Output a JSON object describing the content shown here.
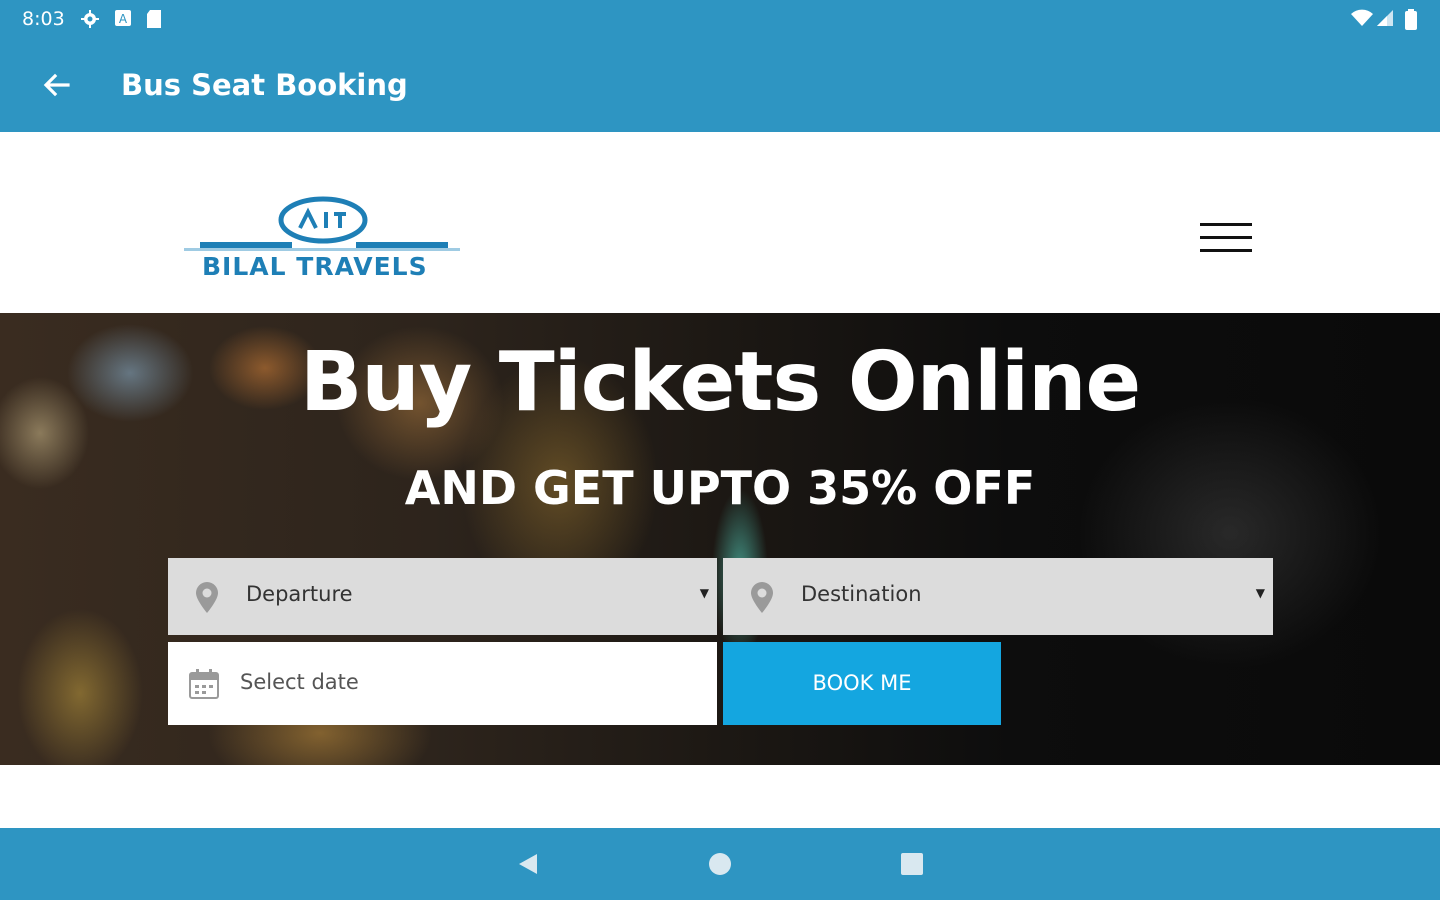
{
  "status_bar": {
    "time": "8:03",
    "left_icons": [
      "gear-icon",
      "a-icon",
      "sd-card-icon"
    ],
    "right_icons": [
      "wifi-icon",
      "signal-icon",
      "battery-icon"
    ]
  },
  "app_bar": {
    "title": "Bus Seat Booking",
    "back_icon": "arrow-left-icon"
  },
  "site_header": {
    "logo_text": "BILAL TRAVELS",
    "menu_icon": "hamburger-icon"
  },
  "hero": {
    "title": "Buy Tickets Online",
    "subtitle": "AND GET UPTO 35% OFF"
  },
  "form": {
    "departure": {
      "value": "Departure",
      "icon": "map-pin-icon"
    },
    "destination": {
      "value": "Destination",
      "icon": "map-pin-icon"
    },
    "date": {
      "placeholder": "Select date",
      "icon": "calendar-icon"
    },
    "book_button": "BOOK ME"
  },
  "nav_bar": {
    "items": [
      "back-triangle-icon",
      "home-circle-icon",
      "recents-square-icon"
    ]
  },
  "colors": {
    "primary": "#2e95c2",
    "button": "#14a6e0",
    "logo": "#1e7fb6"
  }
}
